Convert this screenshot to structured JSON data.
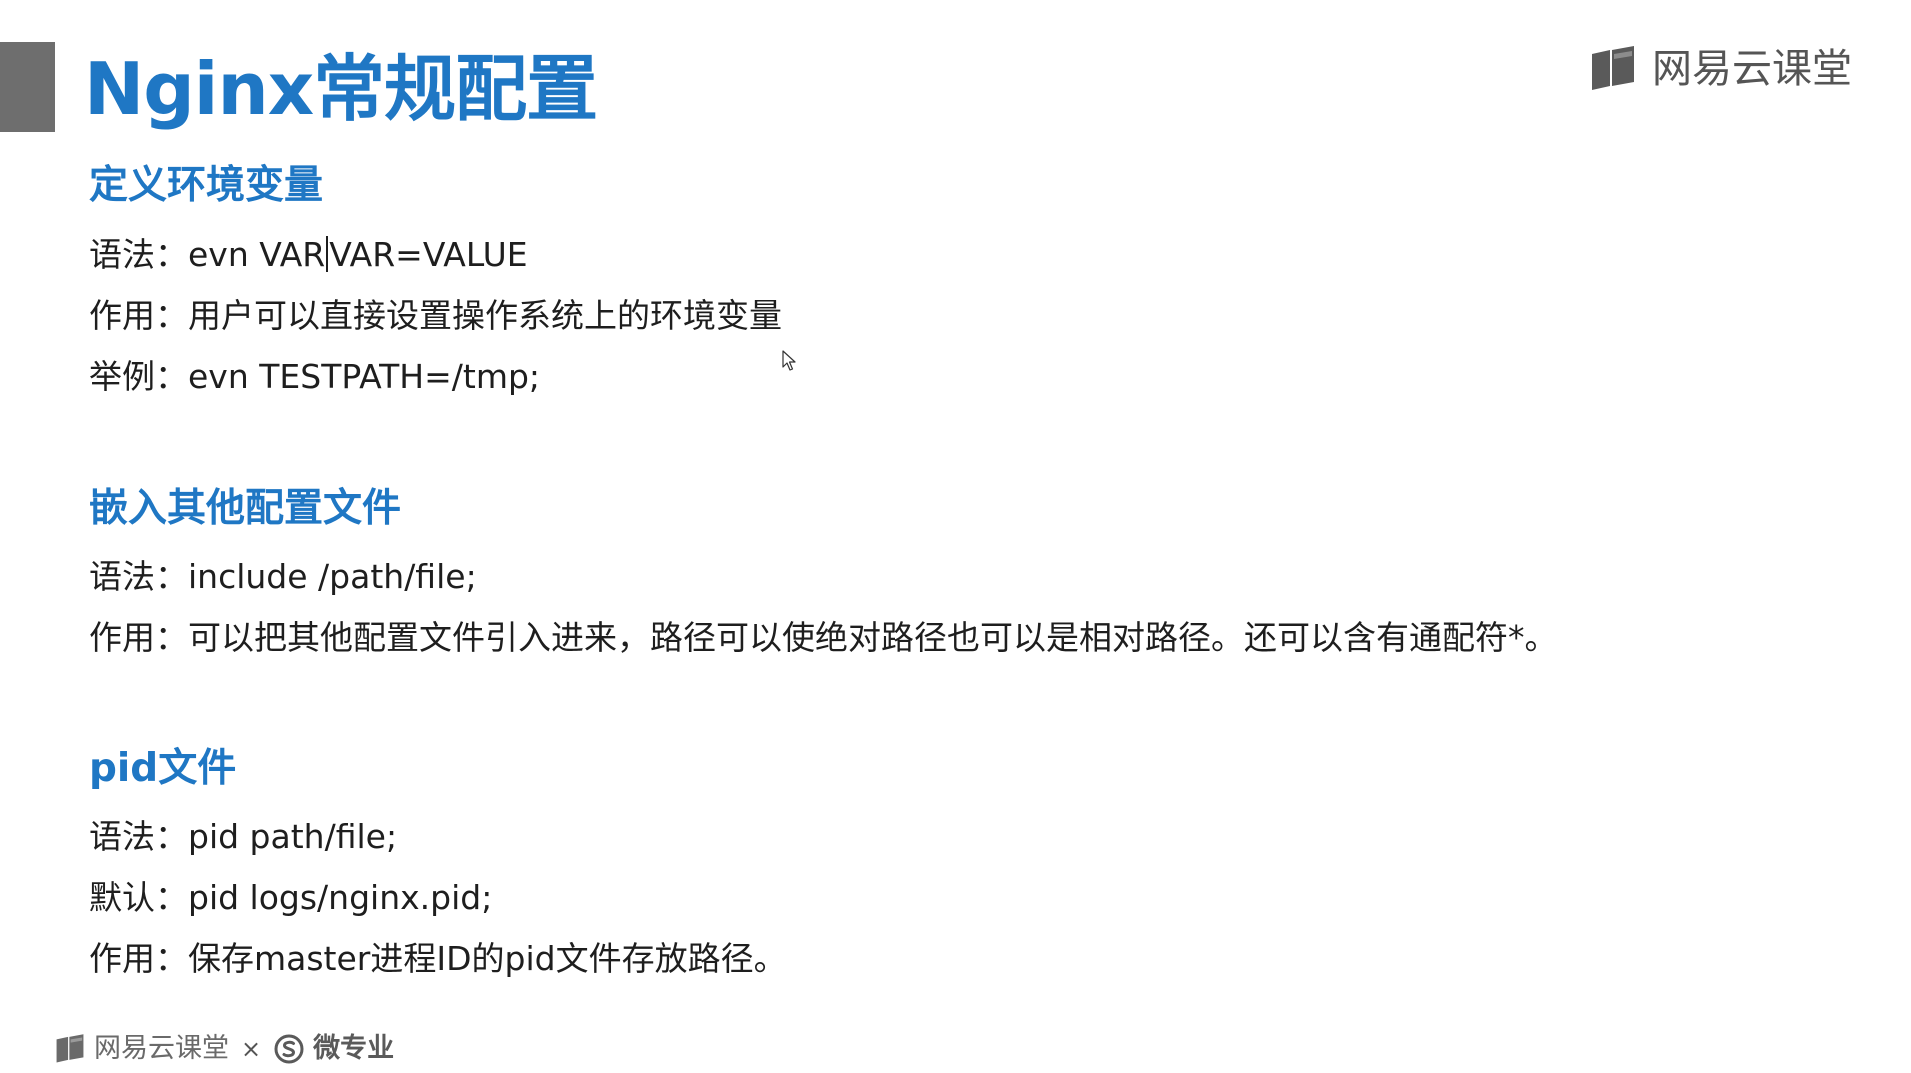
{
  "slide": {
    "title": "Nginx常规配置",
    "brand": {
      "name": "网易云课堂",
      "footer_left": "网易云课堂",
      "footer_separator": "×",
      "footer_right": "微专业"
    },
    "sections": [
      {
        "heading": "定义环境变量",
        "lines": [
          {
            "label": "语法：",
            "value_a": "evn VAR",
            "value_b": "VAR=VALUE"
          },
          {
            "label": "作用：",
            "value": "用户可以直接设置操作系统上的环境变量"
          },
          {
            "label": "举例：",
            "value": "evn TESTPATH=/tmp;"
          }
        ]
      },
      {
        "heading": "嵌入其他配置文件",
        "lines": [
          {
            "label": "语法：",
            "value": "include /path/file;"
          },
          {
            "label": "作用：",
            "value": "可以把其他配置文件引入进来，路径可以使绝对路径也可以是相对路径。还可以含有通配符*。"
          }
        ]
      },
      {
        "heading": "pid文件",
        "lines": [
          {
            "label": "语法：",
            "value": "pid path/file;"
          },
          {
            "label": "默认：",
            "value": "pid logs/nginx.pid;"
          },
          {
            "label": "作用：",
            "value": "保存master进程ID的pid文件存放路径。"
          }
        ]
      }
    ]
  },
  "icons": {
    "brand_logo": "book-icon",
    "footer_logo": "book-icon",
    "footer_badge": "s-circle-icon",
    "cursor": "mouse-pointer-icon"
  },
  "colors": {
    "accent_blue": "#1f77c4",
    "accent_bar": "#6e6e6e",
    "text": "#1e1e1e",
    "brand_gray": "#555555"
  }
}
